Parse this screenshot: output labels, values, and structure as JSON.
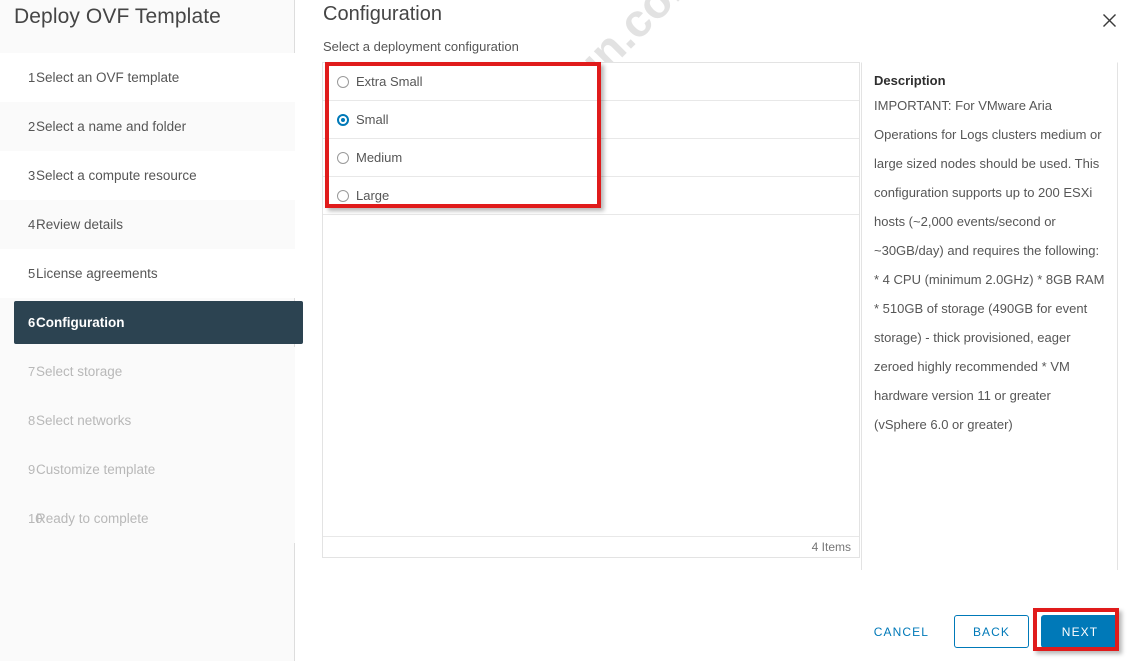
{
  "wizard": {
    "title": "Deploy OVF Template",
    "accent_done_color": "#60b515",
    "accent_active_color": "#2c4351",
    "accent_primary_color": "#0079b8",
    "annotation_color": "#e01b1b"
  },
  "watermark": {
    "text": "mustafakarakoyun.com"
  },
  "steps": [
    {
      "num": "1",
      "label": "Select an OVF template",
      "state": "done"
    },
    {
      "num": "2",
      "label": "Select a name and folder",
      "state": "done"
    },
    {
      "num": "3",
      "label": "Select a compute resource",
      "state": "done"
    },
    {
      "num": "4",
      "label": "Review details",
      "state": "done"
    },
    {
      "num": "5",
      "label": "License agreements",
      "state": "done"
    },
    {
      "num": "6",
      "label": "Configuration",
      "state": "active"
    },
    {
      "num": "7",
      "label": "Select storage",
      "state": "todo"
    },
    {
      "num": "8",
      "label": "Select networks",
      "state": "todo"
    },
    {
      "num": "9",
      "label": "Customize template",
      "state": "todo"
    },
    {
      "num": "10",
      "label": "Ready to complete",
      "state": "todo"
    }
  ],
  "page": {
    "title": "Configuration",
    "subtitle": "Select a deployment configuration",
    "close_icon": "close-icon"
  },
  "configurations": {
    "options": [
      {
        "label": "Extra Small",
        "selected": false
      },
      {
        "label": "Small",
        "selected": true
      },
      {
        "label": "Medium",
        "selected": false
      },
      {
        "label": "Large",
        "selected": false
      }
    ],
    "items_count": "4 Items"
  },
  "description": {
    "title": "Description",
    "body": "IMPORTANT: For VMware Aria Operations for Logs clusters medium or large sized nodes should be used. This configuration supports up to 200 ESXi hosts (~2,000 events/second or ~30GB/day) and requires the following: * 4 CPU (minimum 2.0GHz) * 8GB RAM * 510GB of storage (490GB for event storage) - thick provisioned, eager zeroed highly recommended * VM hardware version 11 or greater (vSphere 6.0 or greater)"
  },
  "footer": {
    "cancel_label": "CANCEL",
    "back_label": "BACK",
    "next_label": "NEXT"
  }
}
